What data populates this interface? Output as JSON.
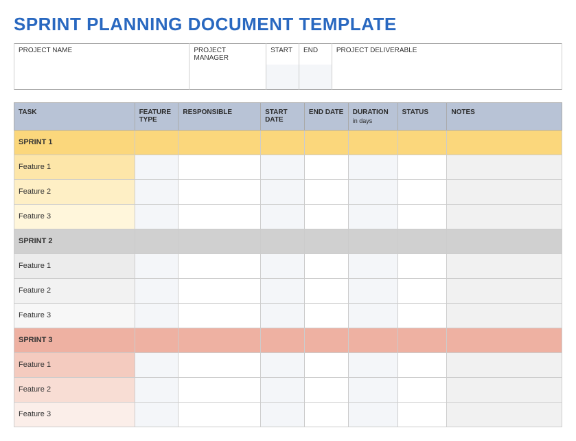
{
  "title": "SPRINT PLANNING DOCUMENT TEMPLATE",
  "project_headers": {
    "name": "PROJECT NAME",
    "manager": "PROJECT MANAGER",
    "start": "START",
    "end": "END",
    "deliverable": "PROJECT DELIVERABLE"
  },
  "project_values": {
    "name": "",
    "manager": "",
    "start": "",
    "end": "",
    "deliverable": ""
  },
  "task_headers": {
    "task": "TASK",
    "feature_type": "FEATURE TYPE",
    "responsible": "RESPONSIBLE",
    "start_date": "START DATE",
    "end_date": "END DATE",
    "duration": "DURATION",
    "duration_sub": "in days",
    "status": "STATUS",
    "notes": "NOTES"
  },
  "rows": [
    {
      "label": "SPRINT 1",
      "cells": [
        "",
        "",
        "",
        "",
        "",
        "",
        ""
      ]
    },
    {
      "label": "Feature 1",
      "cells": [
        "",
        "",
        "",
        "",
        "",
        "",
        ""
      ]
    },
    {
      "label": "Feature 2",
      "cells": [
        "",
        "",
        "",
        "",
        "",
        "",
        ""
      ]
    },
    {
      "label": "Feature 3",
      "cells": [
        "",
        "",
        "",
        "",
        "",
        "",
        ""
      ]
    },
    {
      "label": "SPRINT 2",
      "cells": [
        "",
        "",
        "",
        "",
        "",
        "",
        ""
      ]
    },
    {
      "label": "Feature 1",
      "cells": [
        "",
        "",
        "",
        "",
        "",
        "",
        ""
      ]
    },
    {
      "label": "Feature 2",
      "cells": [
        "",
        "",
        "",
        "",
        "",
        "",
        ""
      ]
    },
    {
      "label": "Feature 3",
      "cells": [
        "",
        "",
        "",
        "",
        "",
        "",
        ""
      ]
    },
    {
      "label": "SPRINT 3",
      "cells": [
        "",
        "",
        "",
        "",
        "",
        "",
        ""
      ]
    },
    {
      "label": "Feature 1",
      "cells": [
        "",
        "",
        "",
        "",
        "",
        "",
        ""
      ]
    },
    {
      "label": "Feature 2",
      "cells": [
        "",
        "",
        "",
        "",
        "",
        "",
        ""
      ]
    },
    {
      "label": "Feature 3",
      "cells": [
        "",
        "",
        "",
        "",
        "",
        "",
        ""
      ]
    }
  ]
}
